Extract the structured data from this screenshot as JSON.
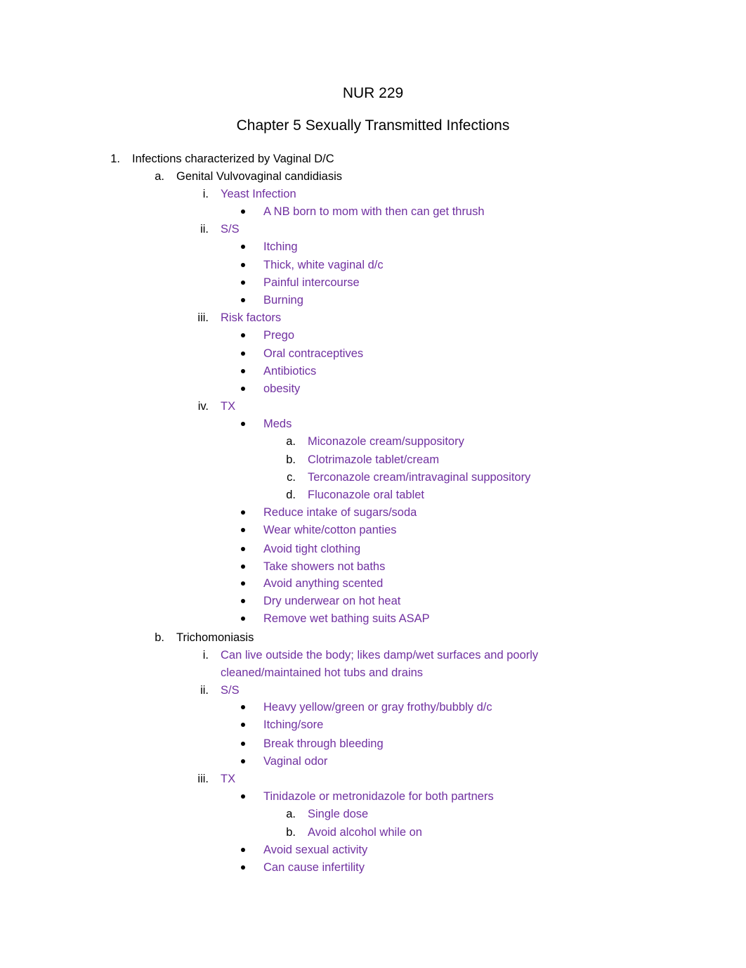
{
  "document": {
    "course": "NUR 229",
    "chapter_title": "Chapter 5 Sexually Transmitted Infections",
    "accent_color": "#7030A0",
    "outline": [
      {
        "marker": "1.",
        "text": "Infections characterized by Vaginal D/C",
        "level": 1,
        "color": "black"
      },
      {
        "marker": "a.",
        "text": "Genital Vulvovaginal candidiasis",
        "level": 2,
        "color": "black"
      },
      {
        "marker": "i.",
        "text": "Yeast Infection",
        "level": 3,
        "color": "purple"
      },
      {
        "marker": "•",
        "text": "A NB born to mom with then can get thrush",
        "level": 4,
        "color": "purple"
      },
      {
        "marker": "ii.",
        "text": "S/S",
        "level": 3,
        "color": "purple"
      },
      {
        "marker": "•",
        "text": "Itching",
        "level": 4,
        "color": "purple"
      },
      {
        "marker": "•",
        "text": "Thick, white vaginal d/c",
        "level": 4,
        "color": "purple"
      },
      {
        "marker": "•",
        "text": "Painful intercourse",
        "level": 4,
        "color": "purple"
      },
      {
        "marker": "•",
        "text": "Burning",
        "level": 4,
        "color": "purple"
      },
      {
        "marker": "iii.",
        "text": "Risk factors",
        "level": 3,
        "color": "purple"
      },
      {
        "marker": "•",
        "text": "Prego",
        "level": 4,
        "color": "purple"
      },
      {
        "marker": "•",
        "text": "Oral contraceptives",
        "level": 4,
        "color": "purple"
      },
      {
        "marker": "•",
        "text": "Antibiotics",
        "level": 4,
        "color": "purple"
      },
      {
        "marker": "•",
        "text": "obesity",
        "level": 4,
        "color": "purple"
      },
      {
        "marker": "iv.",
        "text": "TX",
        "level": 3,
        "color": "purple"
      },
      {
        "marker": "•",
        "text": "Meds",
        "level": 4,
        "color": "purple"
      },
      {
        "marker": "a.",
        "text": "Miconazole cream/suppository",
        "level": 5,
        "color": "purple"
      },
      {
        "marker": "b.",
        "text": "Clotrimazole tablet/cream",
        "level": 5,
        "color": "purple"
      },
      {
        "marker": "c.",
        "text": "Terconazole cream/intravaginal suppository",
        "level": 5,
        "color": "purple"
      },
      {
        "marker": "d.",
        "text": "Fluconazole oral tablet",
        "level": 5,
        "color": "purple"
      },
      {
        "marker": "•",
        "text": "Reduce intake of sugars/soda",
        "level": 4,
        "color": "purple"
      },
      {
        "marker": "•",
        "text": "Wear white/cotton panties",
        "level": 4,
        "color": "purple"
      },
      {
        "marker": "•",
        "text": "Avoid tight clothing",
        "level": 4,
        "color": "purple"
      },
      {
        "marker": "•",
        "text": "Take showers not baths",
        "level": 4,
        "color": "purple"
      },
      {
        "marker": "•",
        "text": "Avoid anything scented",
        "level": 4,
        "color": "purple"
      },
      {
        "marker": "•",
        "text": "Dry underwear on hot heat",
        "level": 4,
        "color": "purple"
      },
      {
        "marker": "•",
        "text": "Remove wet bathing suits ASAP",
        "level": 4,
        "color": "purple"
      },
      {
        "marker": "b.",
        "text": "Trichomoniasis",
        "level": 2,
        "color": "black"
      },
      {
        "marker": "i.",
        "text": "Can live outside the body; likes damp/wet surfaces and poorly",
        "level": 3,
        "color": "purple"
      },
      {
        "marker": "",
        "text": "cleaned/maintained hot tubs and drains",
        "level": 3,
        "color": "purple"
      },
      {
        "marker": "ii.",
        "text": "S/S",
        "level": 3,
        "color": "purple"
      },
      {
        "marker": "•",
        "text": "Heavy yellow/green or gray frothy/bubbly d/c",
        "level": 4,
        "color": "purple"
      },
      {
        "marker": "•",
        "text": "Itching/sore",
        "level": 4,
        "color": "purple"
      },
      {
        "marker": "•",
        "text": "Break through bleeding",
        "level": 4,
        "color": "purple"
      },
      {
        "marker": "•",
        "text": "Vaginal odor",
        "level": 4,
        "color": "purple"
      },
      {
        "marker": "iii.",
        "text": "TX",
        "level": 3,
        "color": "purple"
      },
      {
        "marker": "•",
        "text": "Tinidazole or metronidazole for both partners",
        "level": 4,
        "color": "purple"
      },
      {
        "marker": "a.",
        "text": "Single dose",
        "level": 5,
        "color": "purple"
      },
      {
        "marker": "b.",
        "text": "Avoid alcohol while on",
        "level": 5,
        "color": "purple"
      },
      {
        "marker": "•",
        "text": "Avoid sexual activity",
        "level": 4,
        "color": "purple"
      },
      {
        "marker": "•",
        "text": "Can cause infertility",
        "level": 4,
        "color": "purple"
      }
    ]
  }
}
